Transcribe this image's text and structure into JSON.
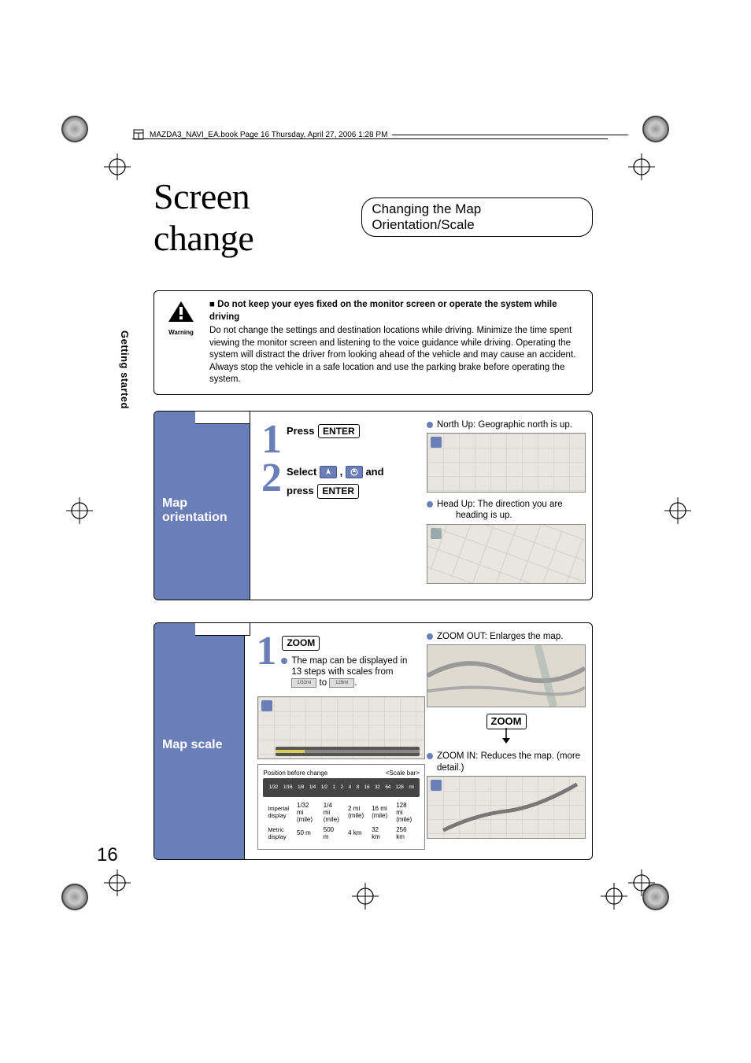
{
  "meta": {
    "bookline": "MAZDA3_NAVI_EA.book  Page 16  Thursday, April 27, 2006  1:28 PM"
  },
  "sidetab": "Getting started",
  "title": {
    "main": "Screen change",
    "sub": "Changing the Map Orientation/Scale"
  },
  "warning": {
    "label": "Warning",
    "heading": "Do not keep your eyes fixed on the monitor screen or operate the system while driving",
    "body": "Do not change the settings and destination locations while driving. Minimize the time spent viewing the monitor screen and listening to the voice guidance while driving. Operating the system will distract the driver from looking ahead of the vehicle and may cause an accident. Always stop the vehicle in a safe location and use the parking brake before operating the system."
  },
  "section_orientation": {
    "title_l1": "Map",
    "title_l2": "orientation",
    "step1": {
      "num": "1",
      "prefix": "Press",
      "btn": "ENTER"
    },
    "step2": {
      "num": "2",
      "prefix": "Select",
      "comma": ",",
      "and": "and",
      "press": "press",
      "btn": "ENTER"
    },
    "right": {
      "north": "North Up: Geographic north is up.",
      "head_l1": "Head Up: The direction you are",
      "head_l2": "heading is up."
    }
  },
  "section_scale": {
    "title": "Map scale",
    "step1": {
      "num": "1",
      "btn": "ZOOM"
    },
    "note_l1": "The map can be displayed in",
    "note_l2": "13 steps with scales from",
    "to": "to",
    "period": ".",
    "scale_panel": {
      "pos_label": "Position before change",
      "bar_label": "<Scale bar>",
      "ruler_ticks": [
        "1/32",
        "1/16",
        "1/8",
        "1/4",
        "1/2",
        "1",
        "2",
        "4",
        "8",
        "16",
        "32",
        "64",
        "128",
        "mi"
      ],
      "row_imp_hdr1": "Imperial",
      "row_imp_hdr2": "display",
      "unit_imp": "(mile)",
      "imp": [
        "1/32 mi",
        "1/4 mi",
        "2 mi",
        "16 mi",
        "128 mi"
      ],
      "row_met_hdr1": "Metric",
      "row_met_hdr2": "display",
      "met": [
        "50 m",
        "500 m",
        "4 km",
        "32 km",
        "256 km"
      ]
    },
    "right": {
      "out": "ZOOM OUT: Enlarges the map.",
      "zoom_btn": "ZOOM",
      "in": "ZOOM IN: Reduces the map. (more detail.)"
    }
  },
  "page_num": "16"
}
